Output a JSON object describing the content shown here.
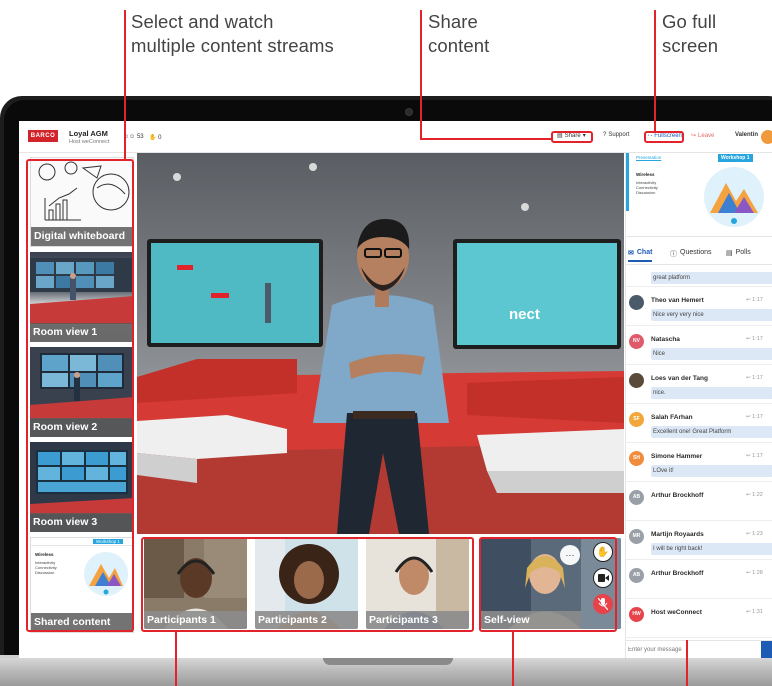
{
  "callouts": {
    "select_line1": "Select and watch",
    "select_line2": "multiple content streams",
    "share_line1": "Share",
    "share_line2": "content",
    "fullscreen_line1": "Go full",
    "fullscreen_line2": "screen"
  },
  "topbar": {
    "logo": "BARCO",
    "meeting_title": "Loyal AGM",
    "meeting_subtitle": "Host weConnect",
    "viewers_count": "53",
    "hands_count": "0",
    "share_label": "Share",
    "support_label": "Support",
    "fullscreen_label": "Fullscreen",
    "leave_label": "Leave",
    "user_name": "Valentin"
  },
  "sources": [
    {
      "label": "Digital whiteboard"
    },
    {
      "label": "Room view 1"
    },
    {
      "label": "Room view 2"
    },
    {
      "label": "Room view 3"
    },
    {
      "label": "Shared content"
    }
  ],
  "shared_slide": {
    "presentation": "Presentation",
    "workshop": "Workshop 1",
    "heading": "Wireless",
    "lines": [
      "Interactivity",
      "Connectivity",
      "Discussion"
    ]
  },
  "participants": [
    {
      "label": "Participants 1"
    },
    {
      "label": "Participants 2"
    },
    {
      "label": "Participants 3"
    }
  ],
  "selfview": {
    "label": "Self-view"
  },
  "tabs": {
    "chat": "Chat",
    "questions": "Questions",
    "polls": "Polls"
  },
  "chat": {
    "partial_text": "great platform",
    "messages": [
      {
        "initials": "",
        "name": "Theo van Hemert",
        "text": "Nice very very nice",
        "time": "1:17",
        "color": "#4a5a6a"
      },
      {
        "initials": "NV",
        "name": "Natascha",
        "text": "Nice",
        "time": "1:17",
        "color": "#e05a6a"
      },
      {
        "initials": "",
        "name": "Loes van der Tang",
        "text": "nice.",
        "time": "1:17",
        "color": "#5a4a3a"
      },
      {
        "initials": "SF",
        "name": "Salah FArhan",
        "text": "Excellent one! Great Platform",
        "time": "1:17",
        "color": "#f3a73a"
      },
      {
        "initials": "SH",
        "name": "Simone Hammer",
        "text": "LOve it!",
        "time": "1:17",
        "color": "#f08c3c"
      },
      {
        "initials": "AB",
        "name": "Arthur Brockhoff",
        "text": "",
        "time": "1:22",
        "color": "#9aa0a8"
      },
      {
        "initials": "MR",
        "name": "Martijn Royaards",
        "text": "I will be right back!",
        "time": "1:23",
        "color": "#9aa0a8"
      },
      {
        "initials": "AB",
        "name": "Arthur Brockhoff",
        "text": "",
        "time": "1:28",
        "color": "#9aa0a8"
      },
      {
        "initials": "HW",
        "name": "Host weConnect",
        "text": "",
        "time": "1:31",
        "color": "#e8434a"
      }
    ],
    "placeholder": "Enter your message"
  },
  "colors": {
    "accent": "#e3232b",
    "brand": "#d2232a",
    "chat_bubble": "#dde8f7"
  }
}
